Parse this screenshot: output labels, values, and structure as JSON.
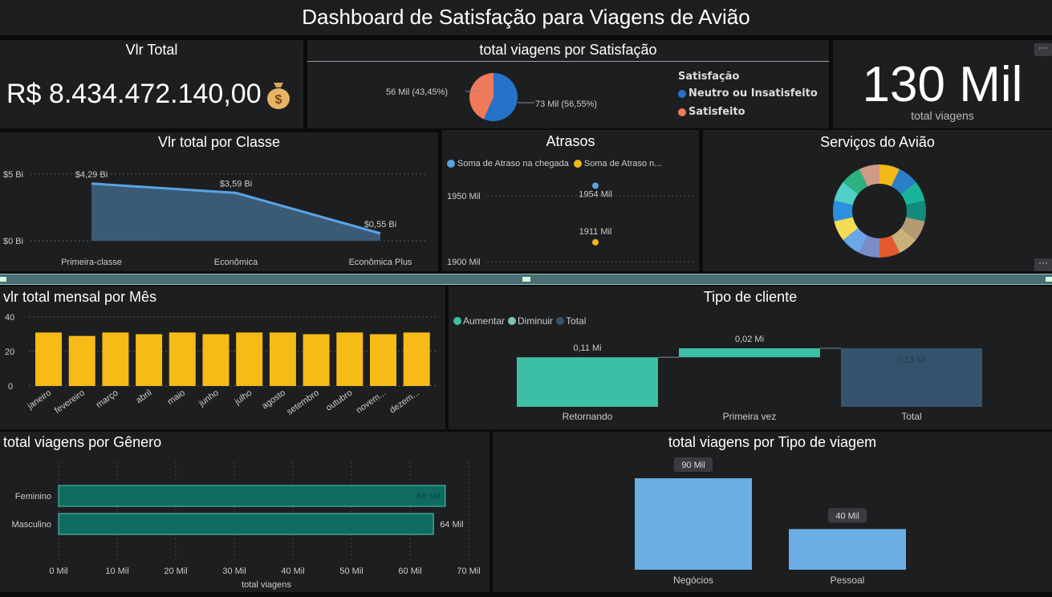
{
  "header": {
    "title": "Dashboard de Satisfação para Viagens de Avião"
  },
  "kpi_total": {
    "title": "Vlr Total",
    "value": "R$ 8.434.472.140,00"
  },
  "satisfaction": {
    "title": "total viagens por Satisfação",
    "legend_title": "Satisfação",
    "colors": {
      "neutral": "#2672c8",
      "satisfied": "#ee7a5a"
    },
    "chart_data": {
      "type": "pie",
      "categories": [
        "Neutro ou Insatisfeito",
        "Satisfeito"
      ],
      "values": [
        73,
        56
      ],
      "labels": [
        "73 Mil (56,55%)",
        "56 Mil (43,45%)"
      ],
      "title": "total viagens por Satisfação"
    }
  },
  "kpi_trips": {
    "value": "130 Mil",
    "label": "total viagens",
    "more": "···"
  },
  "class_chart": {
    "title": "Vlr total por Classe",
    "chart_data": {
      "type": "area",
      "categories": [
        "Primeira-classe",
        "Econômica",
        "Econômica Plus"
      ],
      "values": [
        4.29,
        3.59,
        0.55
      ],
      "data_labels": [
        "$4,29 Bi",
        "$3,59 Bi",
        "$0,55 Bi"
      ],
      "yticks": [
        "$0 Bi",
        "$5 Bi"
      ],
      "ylim": [
        0,
        5
      ]
    }
  },
  "delays": {
    "title": "Atrasos",
    "legend": [
      "Soma de Atraso na chegada",
      "Soma de Atraso n..."
    ],
    "colors": [
      "#5aa3dd",
      "#f2b818"
    ],
    "chart_data": {
      "type": "scatter",
      "series": [
        {
          "name": "Soma de Atraso na chegada",
          "values": [
            1954
          ]
        },
        {
          "name": "Soma de Atraso n...",
          "values": [
            1911
          ]
        }
      ],
      "data_labels": [
        "1954 Mil",
        "1911 Mil"
      ],
      "yticks": [
        "1900 Mil",
        "1950 Mil"
      ],
      "ylim": [
        1900,
        1950
      ]
    }
  },
  "services": {
    "title": "Serviços do Avião",
    "more": "···",
    "colors": [
      "#f2b818",
      "#2a7fc9",
      "#19b39a",
      "#138a7c",
      "#b49b74",
      "#c9b27a",
      "#e45a2e",
      "#7c8cc8",
      "#6aa6e8",
      "#f4dc55",
      "#2c8fe0",
      "#4fd0c8",
      "#2cb27e",
      "#cf9a86"
    ],
    "chart_data": {
      "type": "pie",
      "values": [
        1,
        1,
        1,
        1,
        1,
        1,
        1,
        1,
        1,
        1,
        1,
        1,
        1,
        1
      ]
    }
  },
  "monthly": {
    "title": "vlr total mensal por Mês",
    "chart_data": {
      "type": "bar",
      "categories": [
        "janeiro",
        "fevereiro",
        "março",
        "abril",
        "maio",
        "junho",
        "julho",
        "agosto",
        "setembro",
        "outubro",
        "novem...",
        "dezem..."
      ],
      "values": [
        31,
        29,
        31,
        30,
        31,
        30,
        31,
        31,
        30,
        31,
        30,
        31
      ],
      "yticks": [
        "0",
        "20",
        "40"
      ],
      "ylim": [
        0,
        40
      ]
    }
  },
  "client_type": {
    "title": "Tipo de cliente",
    "legend": [
      "Aumentar",
      "Diminuir",
      "Total"
    ],
    "colors": [
      "#3cbfa4",
      "#7ac3b2",
      "#35536d"
    ],
    "chart_data": {
      "type": "bar",
      "categories": [
        "Retornando",
        "Primeira vez",
        "Total"
      ],
      "values": [
        0.11,
        0.02,
        0.13
      ],
      "data_labels": [
        "0,11 Mi",
        "0,02 Mi",
        "0,13 Mi"
      ]
    }
  },
  "gender": {
    "title": "total viagens por Gênero",
    "chart_data": {
      "type": "bar",
      "categories": [
        "Feminino",
        "Masculino"
      ],
      "values": [
        66,
        64
      ],
      "data_labels": [
        "66 Mil",
        "64 Mil"
      ],
      "xticks": [
        "0 Mil",
        "10 Mil",
        "20 Mil",
        "30 Mil",
        "40 Mil",
        "50 Mil",
        "60 Mil",
        "70 Mil"
      ],
      "xlim": [
        0,
        70
      ],
      "xlabel": "total viagens"
    }
  },
  "trip_type": {
    "title": "total viagens por Tipo de viagem",
    "chart_data": {
      "type": "bar",
      "categories": [
        "Negócios",
        "Pessoal"
      ],
      "values": [
        90,
        40
      ],
      "data_labels": [
        "90 Mil",
        "40 Mil"
      ]
    }
  }
}
